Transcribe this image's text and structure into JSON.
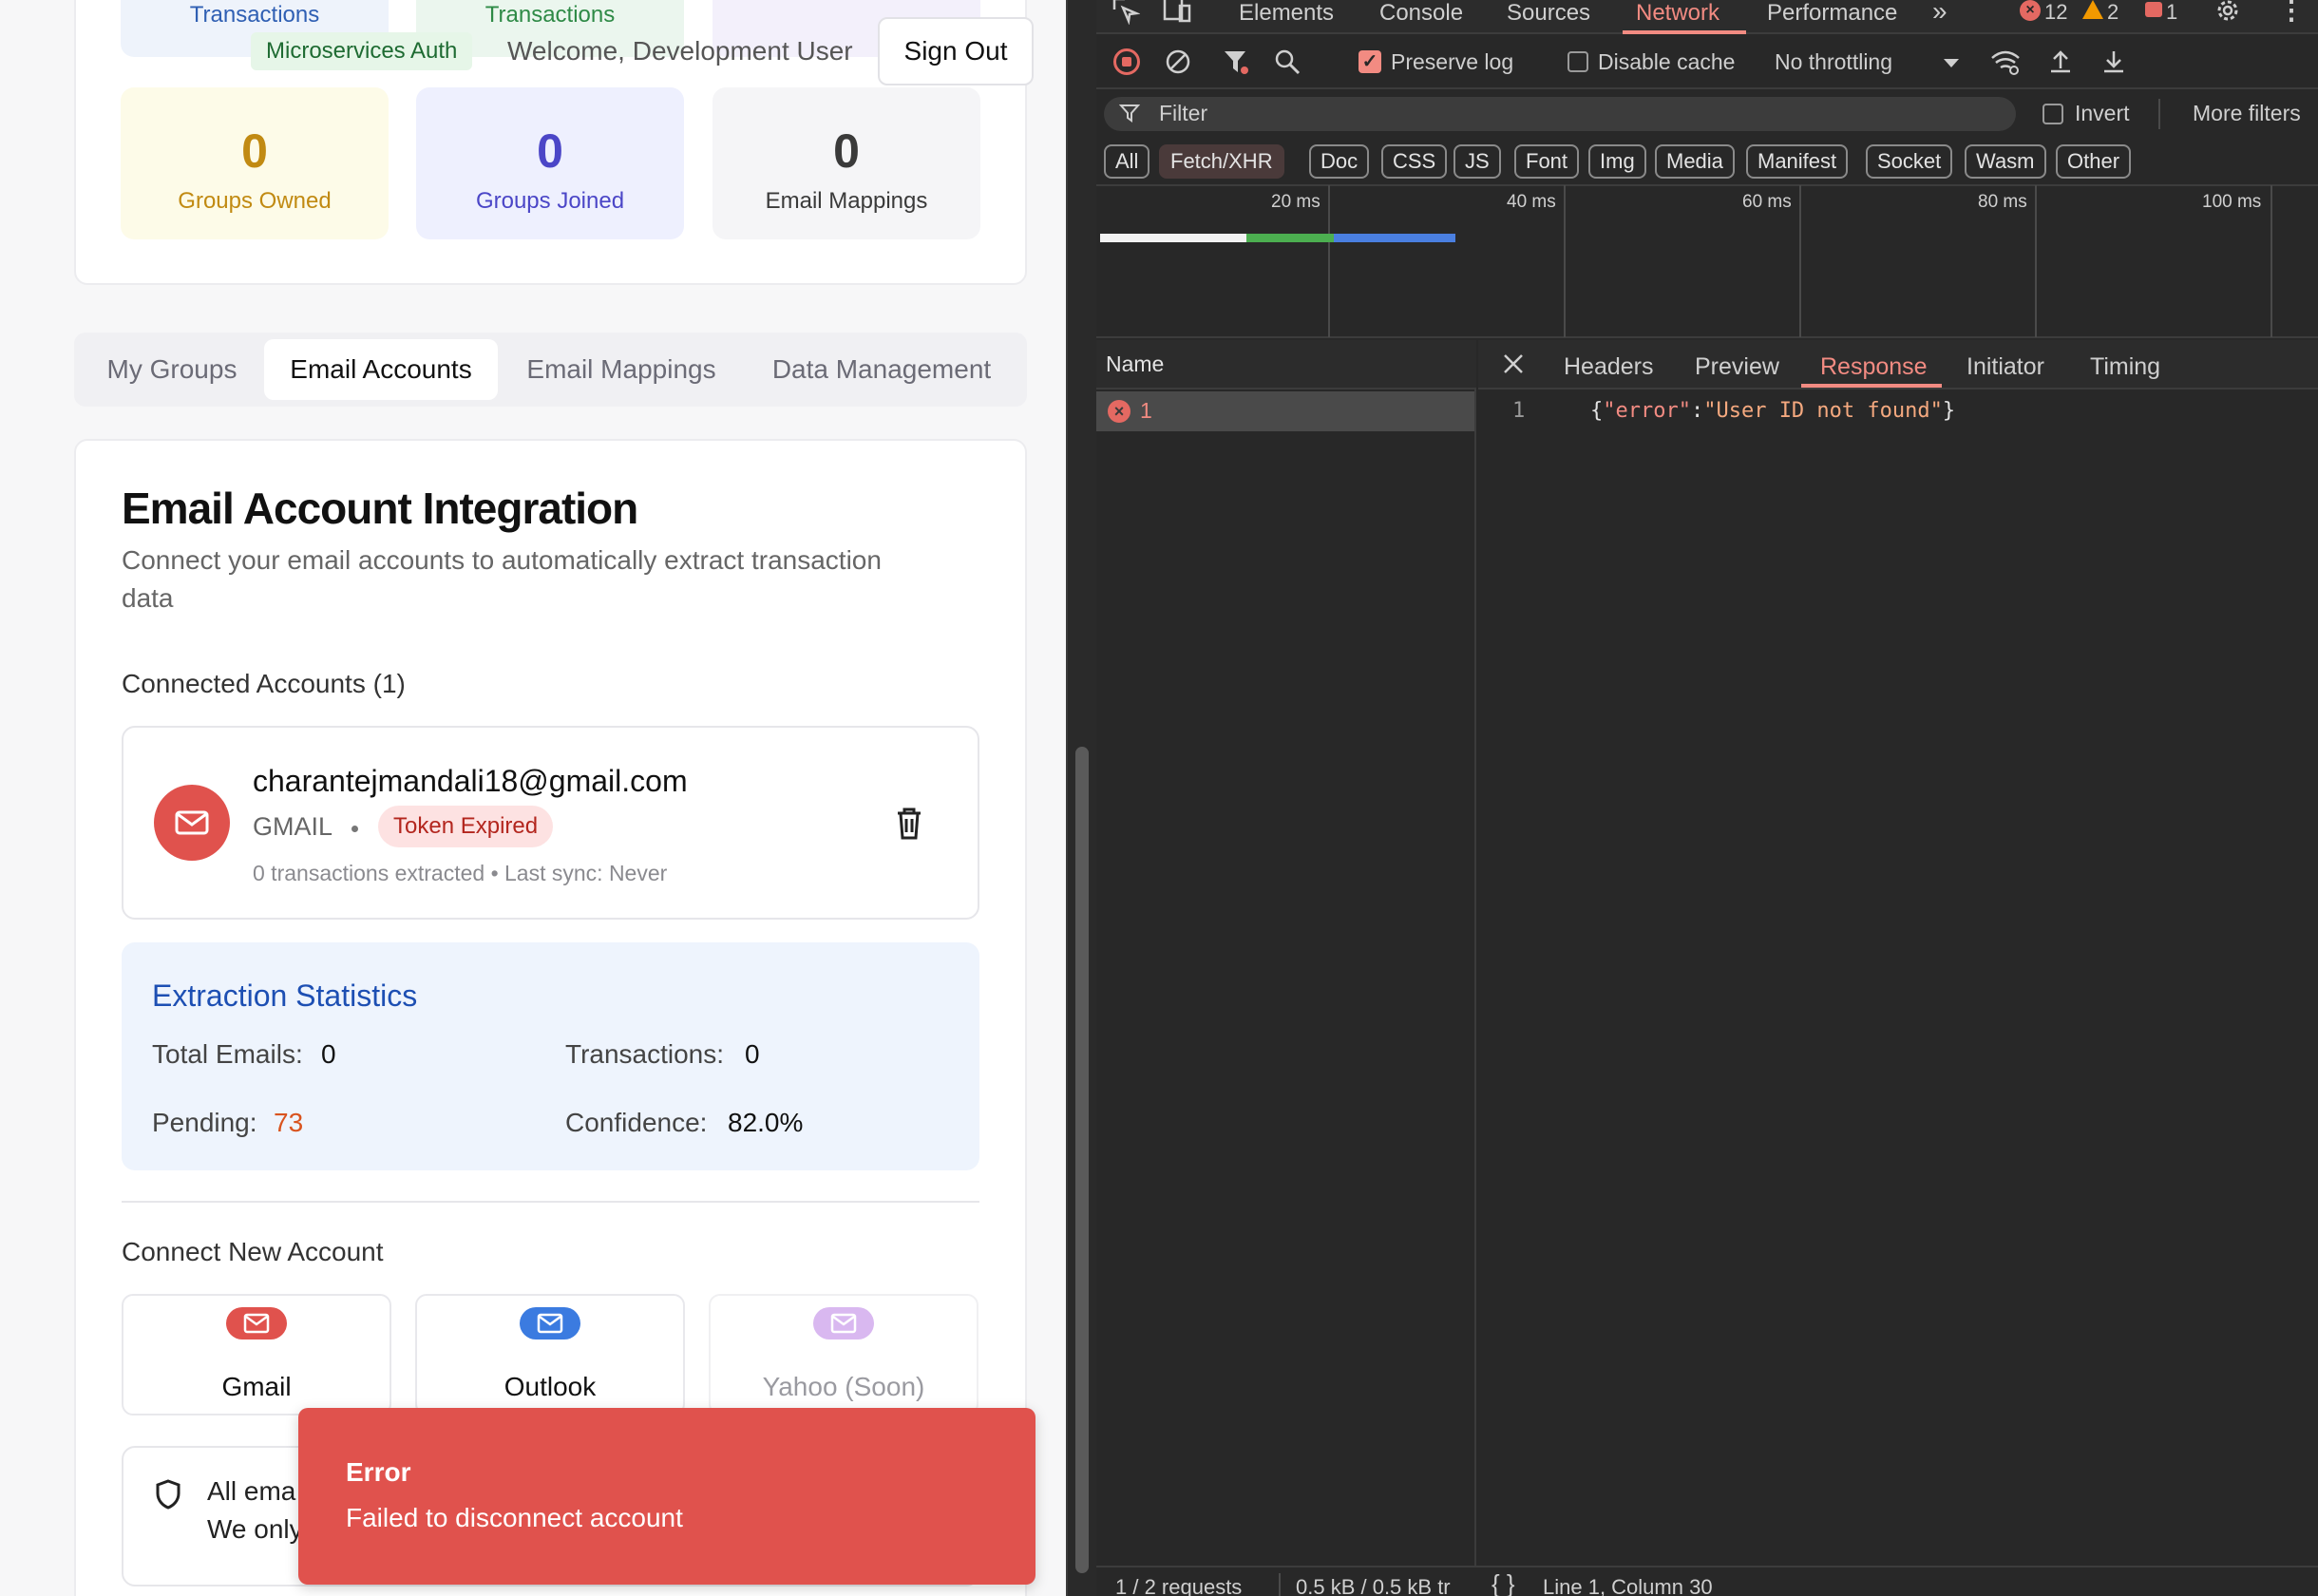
{
  "app": {
    "header": {
      "top_labels": [
        "Transactions",
        "Transactions"
      ],
      "badge": "Microservices Auth",
      "welcome": "Welcome, Development User",
      "sign_out": "Sign Out"
    },
    "stats": [
      {
        "value": "0",
        "label": "Groups Owned",
        "color": "#c18a12"
      },
      {
        "value": "0",
        "label": "Groups Joined",
        "color": "#4b46c7"
      },
      {
        "value": "0",
        "label": "Email Mappings",
        "color": "#3a3a3a"
      }
    ],
    "tabs": [
      "My Groups",
      "Email Accounts",
      "Email Mappings",
      "Data Management"
    ],
    "active_tab": "Email Accounts",
    "integration": {
      "title": "Email Account Integration",
      "subtitle_line1": "Connect your email accounts to automatically extract transaction",
      "subtitle_line2": "data",
      "connected_heading": "Connected Accounts (1)",
      "account": {
        "email": "charantejmandali18@gmail.com",
        "provider": "GMAIL",
        "status": "Token Expired",
        "meta": "0 transactions extracted • Last sync: Never"
      },
      "extraction": {
        "title": "Extraction Statistics",
        "total_emails_label": "Total Emails:",
        "total_emails": "0",
        "transactions_label": "Transactions:",
        "transactions": "0",
        "pending_label": "Pending:",
        "pending": "73",
        "confidence_label": "Confidence:",
        "confidence": "82.0%"
      },
      "connect_heading": "Connect New Account",
      "providers": [
        "Gmail",
        "Outlook",
        "Yahoo (Soon)"
      ],
      "privacy_line1": "All ema",
      "privacy_line2": "We only"
    },
    "toast": {
      "title": "Error",
      "message": "Failed to disconnect account"
    }
  },
  "devtools": {
    "tabs": [
      "Elements",
      "Console",
      "Sources",
      "Network",
      "Performance"
    ],
    "active_tab": "Network",
    "errors": "12",
    "warnings": "2",
    "issues": "1",
    "preserve_log": "Preserve log",
    "disable_cache": "Disable cache",
    "throttling": "No throttling",
    "filter_placeholder": "Filter",
    "invert": "Invert",
    "more_filters": "More filters",
    "type_filters": [
      "All",
      "Fetch/XHR",
      "Doc",
      "CSS",
      "JS",
      "Font",
      "Img",
      "Media",
      "Manifest",
      "Socket",
      "Wasm",
      "Other"
    ],
    "timeline_ticks": [
      "20 ms",
      "40 ms",
      "60 ms",
      "80 ms",
      "100 ms"
    ],
    "name_header": "Name",
    "request_name": "1",
    "detail_tabs": [
      "Headers",
      "Preview",
      "Response",
      "Initiator",
      "Timing"
    ],
    "active_detail_tab": "Response",
    "response_line_no": "1",
    "response_key": "\"error\"",
    "response_colon": ":",
    "response_value": "\"User ID not found\"",
    "status_bar": {
      "requests": "1 / 2 requests",
      "transferred": "0.5 kB / 0.5 kB tr",
      "position": "Line 1, Column 30"
    }
  },
  "colors": {
    "accent_red": "#e0524d",
    "devtools_bg": "#282828",
    "active_tab": "#f28b82"
  }
}
